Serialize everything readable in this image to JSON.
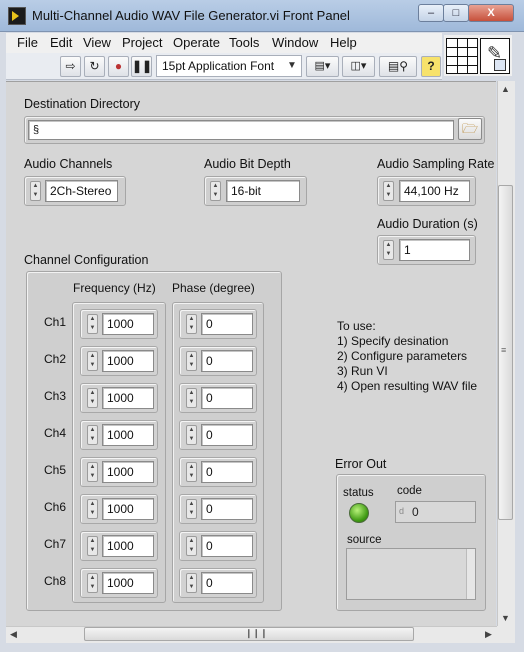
{
  "window": {
    "title": "Multi-Channel Audio WAV File Generator.vi Front Panel",
    "buttons": {
      "minimize": "–",
      "maximize": "□",
      "close": "X"
    }
  },
  "menu": [
    "File",
    "Edit",
    "View",
    "Project",
    "Operate",
    "Tools",
    "Window",
    "Help"
  ],
  "toolbar": {
    "font_select_value": "15pt Application Font",
    "icons": [
      "run-arrow-icon",
      "run-continuously-icon",
      "abort-icon",
      "pause-icon",
      "align-icon",
      "distribute-icon",
      "search-icon",
      "help-icon"
    ]
  },
  "destination": {
    "label": "Destination Directory",
    "path_glyph": "§",
    "value": "",
    "browse_icon": "folder-open-icon"
  },
  "channels": {
    "label": "Audio Channels",
    "value": "2Ch-Stereo"
  },
  "bit_depth": {
    "label": "Audio Bit Depth",
    "value": "16-bit"
  },
  "sampling_rate": {
    "label": "Audio Sampling Rate",
    "value": "44,100 Hz"
  },
  "duration": {
    "label": "Audio Duration (s)",
    "value": "1"
  },
  "channel_config": {
    "label": "Channel Configuration",
    "frequency_header": "Frequency (Hz)",
    "phase_header": "Phase (degree)",
    "rows": [
      {
        "name": "Ch1",
        "frequency": "1000",
        "phase": "0"
      },
      {
        "name": "Ch2",
        "frequency": "1000",
        "phase": "0"
      },
      {
        "name": "Ch3",
        "frequency": "1000",
        "phase": "0"
      },
      {
        "name": "Ch4",
        "frequency": "1000",
        "phase": "0"
      },
      {
        "name": "Ch5",
        "frequency": "1000",
        "phase": "0"
      },
      {
        "name": "Ch6",
        "frequency": "1000",
        "phase": "0"
      },
      {
        "name": "Ch7",
        "frequency": "1000",
        "phase": "0"
      },
      {
        "name": "Ch8",
        "frequency": "1000",
        "phase": "0"
      }
    ]
  },
  "instructions": {
    "heading": "To use:",
    "steps": [
      "1) Specify desination",
      "2) Configure parameters",
      "3) Run VI",
      "4) Open resulting WAV file"
    ]
  },
  "error_out": {
    "label": "Error Out",
    "status_label": "status",
    "status_color": "#4fb021",
    "code_label": "code",
    "code_prefix": "d",
    "code_value": "0",
    "source_label": "source",
    "source_value": ""
  },
  "colors": {
    "panel": "#d6d6d6",
    "titlebar": "#b9cde6"
  }
}
